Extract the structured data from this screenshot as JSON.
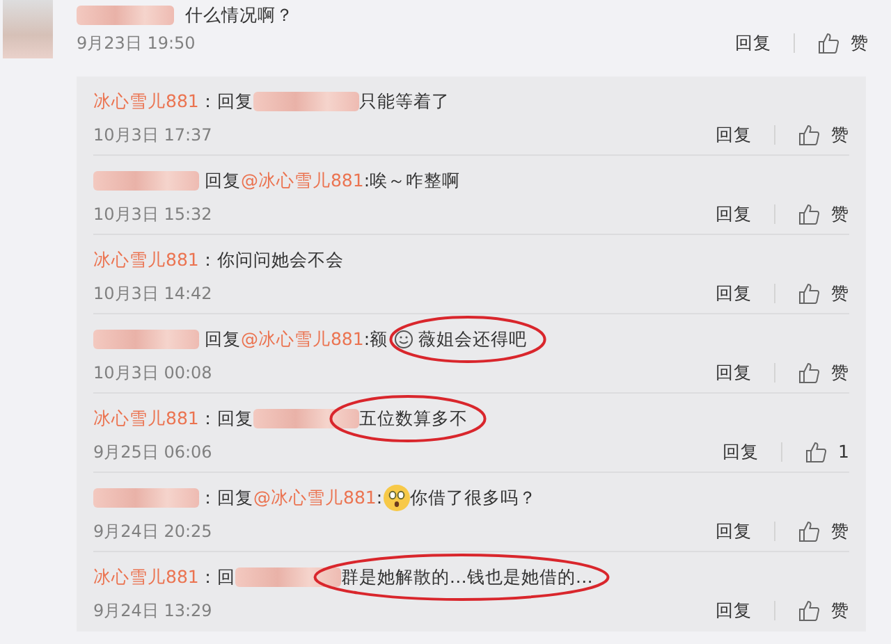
{
  "comment": {
    "text": "什么情况啊？",
    "time": "9月23日 19:50",
    "reply_label": "回复",
    "like_label": "赞"
  },
  "replies": [
    {
      "segments": [
        {
          "kind": "author",
          "text": "冰心雪儿881"
        },
        {
          "kind": "text",
          "text": "：回复"
        },
        {
          "kind": "blur"
        },
        {
          "kind": "text",
          "text": "只能等着了"
        }
      ],
      "time": "10月3日 17:37",
      "reply_label": "回复",
      "like_label": "赞",
      "circled": false
    },
    {
      "segments": [
        {
          "kind": "blur"
        },
        {
          "kind": "text",
          "text": " 回复"
        },
        {
          "kind": "mention",
          "text": "@冰心雪儿881"
        },
        {
          "kind": "text",
          "text": ":唉～咋整啊"
        }
      ],
      "time": "10月3日 15:32",
      "reply_label": "回复",
      "like_label": "赞",
      "circled": false
    },
    {
      "segments": [
        {
          "kind": "author",
          "text": "冰心雪儿881"
        },
        {
          "kind": "text",
          "text": "：你问问她会不会"
        }
      ],
      "time": "10月3日 14:42",
      "reply_label": "回复",
      "like_label": "赞",
      "circled": false
    },
    {
      "segments": [
        {
          "kind": "blur"
        },
        {
          "kind": "text",
          "text": " 回复"
        },
        {
          "kind": "mention",
          "text": "@冰心雪儿881"
        },
        {
          "kind": "text",
          "text": ":额"
        },
        {
          "kind": "emoji-smile"
        },
        {
          "kind": "body",
          "text": "薇姐会还得吧"
        }
      ],
      "time": "10月3日 00:08",
      "reply_label": "回复",
      "like_label": "赞",
      "circled": true
    },
    {
      "segments": [
        {
          "kind": "author",
          "text": "冰心雪儿881"
        },
        {
          "kind": "text",
          "text": "：回复"
        },
        {
          "kind": "blur"
        },
        {
          "kind": "body",
          "text": "五位数算多不"
        }
      ],
      "time": "9月25日 06:06",
      "reply_label": "回复",
      "like_label": "1",
      "circled": true
    },
    {
      "segments": [
        {
          "kind": "blur"
        },
        {
          "kind": "text",
          "text": "：回复"
        },
        {
          "kind": "mention",
          "text": "@冰心雪儿881"
        },
        {
          "kind": "text",
          "text": ":"
        },
        {
          "kind": "emoji-surprised"
        },
        {
          "kind": "text",
          "text": "你借了很多吗？"
        }
      ],
      "time": "9月24日 20:25",
      "reply_label": "回复",
      "like_label": "赞",
      "circled": false
    },
    {
      "segments": [
        {
          "kind": "author",
          "text": "冰心雪儿881"
        },
        {
          "kind": "text",
          "text": "：回"
        },
        {
          "kind": "blur"
        },
        {
          "kind": "body",
          "text": "群是她解散的…钱也是她借的…"
        }
      ],
      "time": "9月24日 13:29",
      "reply_label": "回复",
      "like_label": "赞",
      "circled": true
    }
  ]
}
